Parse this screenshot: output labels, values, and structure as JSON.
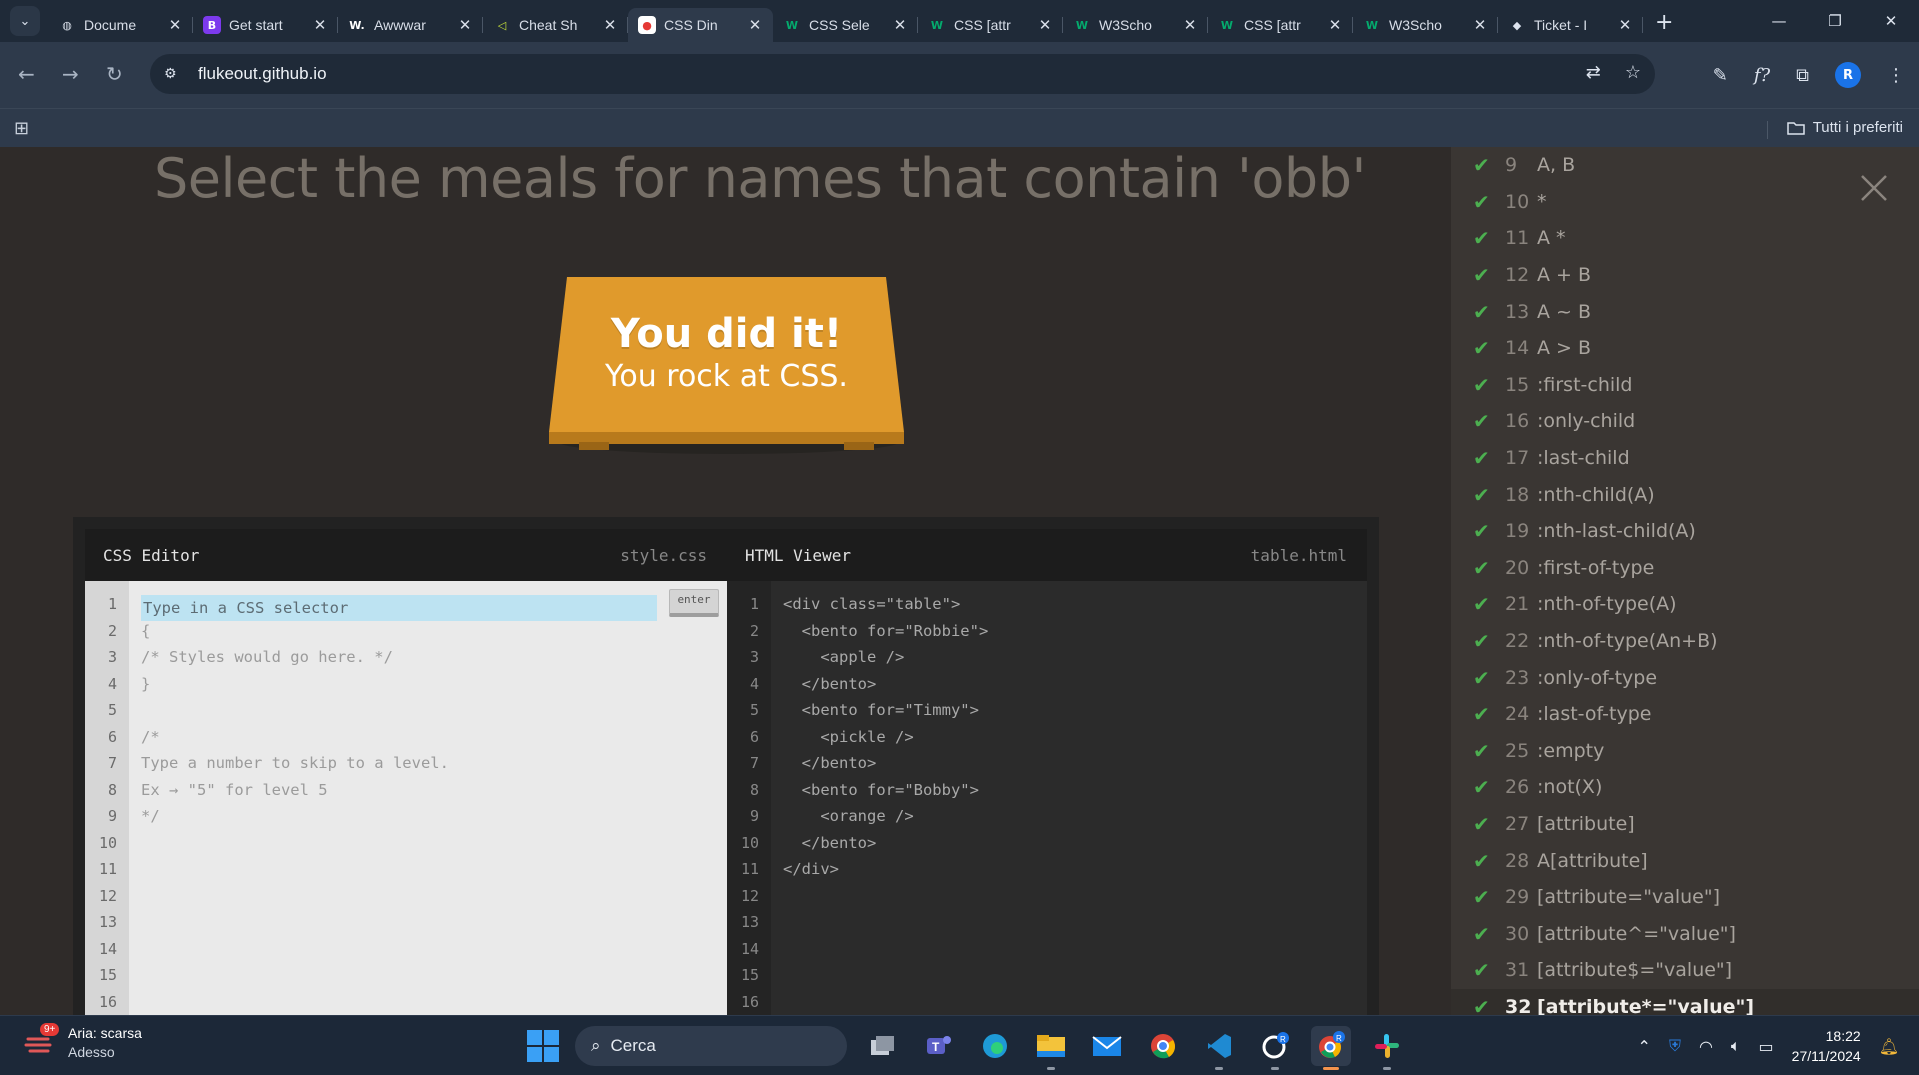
{
  "browser": {
    "tabs": [
      {
        "title": "Docume",
        "icon": "globe-icon",
        "active": false
      },
      {
        "title": "Get start",
        "icon": "bootstrap-icon",
        "active": false
      },
      {
        "title": "Awwwar",
        "icon": "awwwards-icon",
        "active": false
      },
      {
        "title": "Cheat Sh",
        "icon": "cheatsheet-icon",
        "active": false
      },
      {
        "title": "CSS Din",
        "icon": "css-diner-icon",
        "active": true
      },
      {
        "title": "CSS Sele",
        "icon": "w3schools-icon",
        "active": false
      },
      {
        "title": "CSS [attr",
        "icon": "w3schools-icon",
        "active": false
      },
      {
        "title": "W3Scho",
        "icon": "w3schools-icon",
        "active": false
      },
      {
        "title": "CSS [attr",
        "icon": "w3schools-icon",
        "active": false
      },
      {
        "title": "W3Scho",
        "icon": "w3schools-icon",
        "active": false
      },
      {
        "title": "Ticket - I",
        "icon": "ticket-icon",
        "active": false
      }
    ],
    "url": "flukeout.github.io",
    "bookmarks_folder": "Tutti i preferiti",
    "profile_initial": "R"
  },
  "game": {
    "instruction": "Select the meals for names that contain 'obb'",
    "win_line1": "You did it!",
    "win_line2": "You rock at CSS.",
    "css_editor": {
      "title": "CSS Editor",
      "file": "style.css",
      "input_placeholder": "Type in a CSS selector",
      "enter_label": "enter",
      "lines": [
        "",
        "{",
        "/* Styles would go here. */",
        "}",
        "",
        "/*",
        "Type a number to skip to a level.",
        "Ex → \"5\" for level 5",
        "*/",
        "",
        "",
        "",
        "",
        "",
        "",
        ""
      ]
    },
    "html_viewer": {
      "title": "HTML Viewer",
      "file": "table.html",
      "lines": [
        "<div class=\"table\">",
        "  <bento for=\"Robbie\">",
        "    <apple />",
        "  </bento>",
        "  <bento for=\"Timmy\">",
        "    <pickle />",
        "  </bento>",
        "  <bento for=\"Bobby\">",
        "    <orange />",
        "  </bento>",
        "</div>",
        "",
        "",
        "",
        "",
        ""
      ]
    },
    "levels": [
      {
        "num": "9",
        "selector": "A, B"
      },
      {
        "num": "10",
        "selector": "*"
      },
      {
        "num": "11",
        "selector": "A *"
      },
      {
        "num": "12",
        "selector": "A + B"
      },
      {
        "num": "13",
        "selector": "A ~ B"
      },
      {
        "num": "14",
        "selector": "A > B"
      },
      {
        "num": "15",
        "selector": ":first-child"
      },
      {
        "num": "16",
        "selector": ":only-child"
      },
      {
        "num": "17",
        "selector": ":last-child"
      },
      {
        "num": "18",
        "selector": ":nth-child(A)"
      },
      {
        "num": "19",
        "selector": ":nth-last-child(A)"
      },
      {
        "num": "20",
        "selector": ":first-of-type"
      },
      {
        "num": "21",
        "selector": ":nth-of-type(A)"
      },
      {
        "num": "22",
        "selector": ":nth-of-type(An+B)"
      },
      {
        "num": "23",
        "selector": ":only-of-type"
      },
      {
        "num": "24",
        "selector": ":last-of-type"
      },
      {
        "num": "25",
        "selector": ":empty"
      },
      {
        "num": "26",
        "selector": ":not(X)"
      },
      {
        "num": "27",
        "selector": "[attribute]"
      },
      {
        "num": "28",
        "selector": "A[attribute]"
      },
      {
        "num": "29",
        "selector": "[attribute=\"value\"]"
      },
      {
        "num": "30",
        "selector": "[attribute^=\"value\"]"
      },
      {
        "num": "31",
        "selector": "[attribute$=\"value\"]"
      },
      {
        "num": "32",
        "selector": "[attribute*=\"value\"]"
      }
    ],
    "current_level": "32",
    "check_color": "#4caf50",
    "table_color": "#e09a2c"
  },
  "taskbar": {
    "weather_badge": "9+",
    "weather_title": "Aria: scarsa",
    "weather_sub": "Adesso",
    "search_placeholder": "Cerca",
    "apps": [
      "task-view-icon",
      "teams-icon",
      "edge-icon",
      "file-explorer-icon",
      "mail-icon",
      "chrome-icon",
      "vscode-icon",
      "github-icon",
      "chrome-profile-icon",
      "slack-icon"
    ],
    "time": "18:22",
    "date": "27/11/2024"
  }
}
